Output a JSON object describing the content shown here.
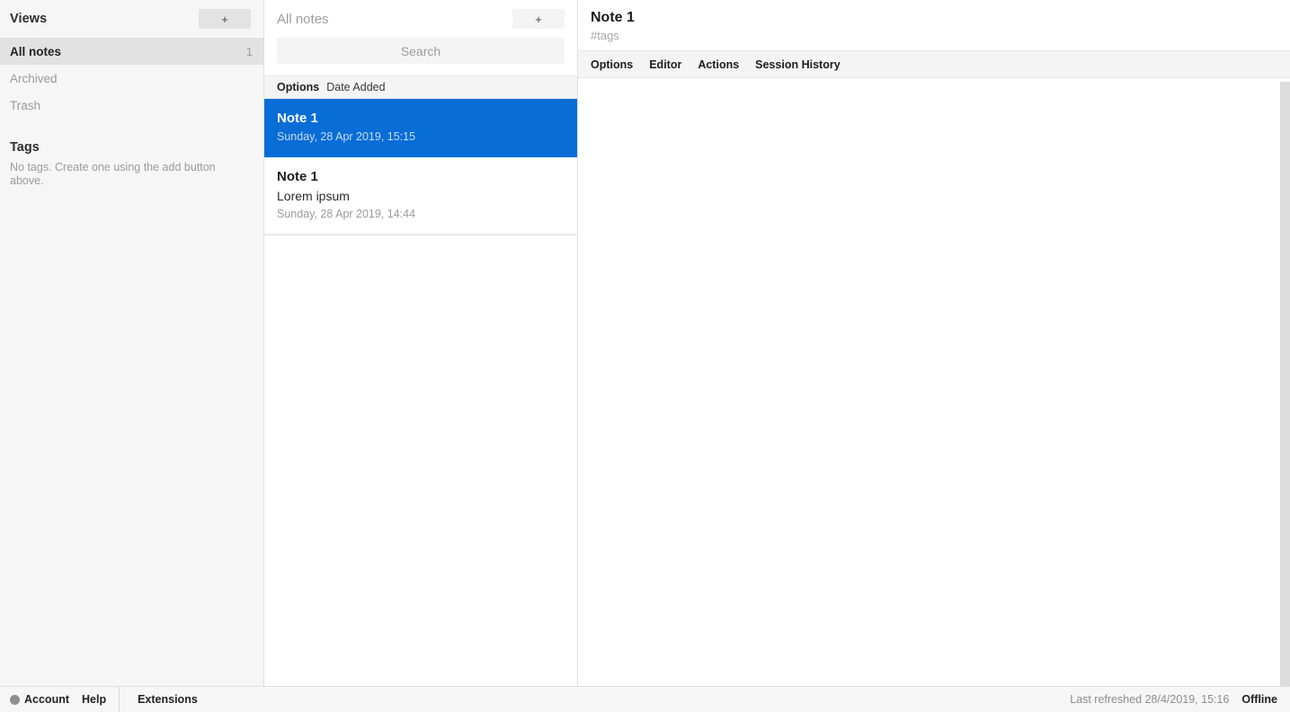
{
  "sidebar": {
    "header": {
      "title": "Views",
      "add_label": "+"
    },
    "views": [
      {
        "label": "All notes",
        "count": "1",
        "selected": true
      },
      {
        "label": "Archived",
        "count": "",
        "selected": false
      },
      {
        "label": "Trash",
        "count": "",
        "selected": false
      }
    ],
    "tags": {
      "title": "Tags",
      "empty_message": "No tags. Create one using the add button above."
    }
  },
  "notes_panel": {
    "header": {
      "title": "All notes",
      "add_label": "+"
    },
    "search": {
      "value": "",
      "placeholder": "Search"
    },
    "toolbar": {
      "options_label": "Options",
      "sort_label": "Date Added"
    },
    "notes": [
      {
        "title": "Note 1",
        "preview": "",
        "date": "Sunday, 28 Apr 2019, 15:15",
        "selected": true
      },
      {
        "title": "Note 1",
        "preview": "Lorem ipsum",
        "date": "Sunday, 28 Apr 2019, 14:44",
        "selected": false
      }
    ]
  },
  "editor": {
    "title": "Note 1",
    "tags_placeholder": "#tags",
    "tags_value": "",
    "tabs": [
      {
        "label": "Options"
      },
      {
        "label": "Editor"
      },
      {
        "label": "Actions"
      },
      {
        "label": "Session History"
      }
    ],
    "body_text": "",
    "body_placeholder": ""
  },
  "statusbar": {
    "account_label": "Account",
    "help_label": "Help",
    "extensions_label": "Extensions",
    "last_refreshed": "Last refreshed 28/4/2019, 15:16",
    "connection_status": "Offline"
  },
  "colors": {
    "accent": "#086DD6",
    "panel_bg": "#f6f6f6",
    "toolbar_bg": "#f4f4f4",
    "border": "#dfdfdf",
    "muted_text": "#9b9b9b",
    "account_dot": "#8e8e8e"
  }
}
